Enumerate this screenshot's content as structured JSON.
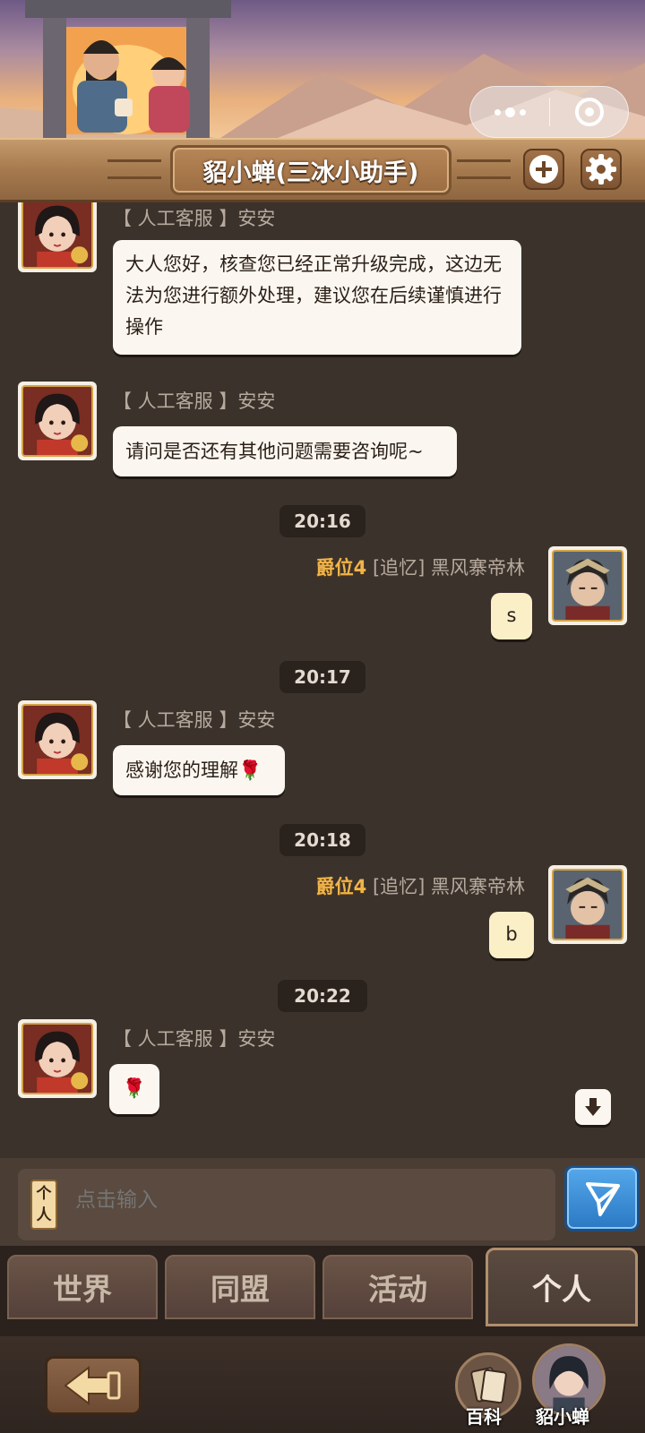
{
  "header": {
    "title": "貂小蝉(三冰小助手)",
    "add_icon": "plus-circle-icon",
    "settings_icon": "gear-icon"
  },
  "capsule": {
    "more_icon": "more-dots-icon",
    "close_icon": "target-close-icon"
  },
  "messages": [
    {
      "type": "received",
      "name": "【 人工客服 】安安",
      "text": "大人您好，核查您已经正常升级完成，这边无法为您进行额外处理，建议您在后续谨慎进行操作"
    },
    {
      "type": "received",
      "name": "【 人工客服 】安安",
      "text": "请问是否还有其他问题需要咨询呢~"
    },
    {
      "type": "time",
      "text": "20:16"
    },
    {
      "type": "sent",
      "rank": "爵位4",
      "name": "[追忆] 黑风寨帝林",
      "text": "s"
    },
    {
      "type": "time",
      "text": "20:17"
    },
    {
      "type": "received",
      "name": "【 人工客服 】安安",
      "text": "感谢您的理解",
      "emoji": "🌹"
    },
    {
      "type": "time",
      "text": "20:18"
    },
    {
      "type": "sent",
      "rank": "爵位4",
      "name": "[追忆] 黑风寨帝林",
      "text": "b"
    },
    {
      "type": "time",
      "text": "20:22"
    },
    {
      "type": "received",
      "name": "【 人工客服 】安安",
      "text": "",
      "emoji": "🌹"
    }
  ],
  "input": {
    "mode_tag": "个人",
    "placeholder": "点击输入"
  },
  "tabs": [
    {
      "label": "世界",
      "active": false
    },
    {
      "label": "同盟",
      "active": false
    },
    {
      "label": "活动",
      "active": false
    },
    {
      "label": "个人",
      "active": true
    }
  ],
  "bottom": {
    "wiki_label": "百科",
    "assistant_label": "貂小蝉"
  },
  "colors": {
    "background": "#3b322c",
    "bubble": "#fbf7f0",
    "bubble_sent": "#fbefc8",
    "rank": "#f0b44a",
    "send_button": "#3a8fd8"
  }
}
